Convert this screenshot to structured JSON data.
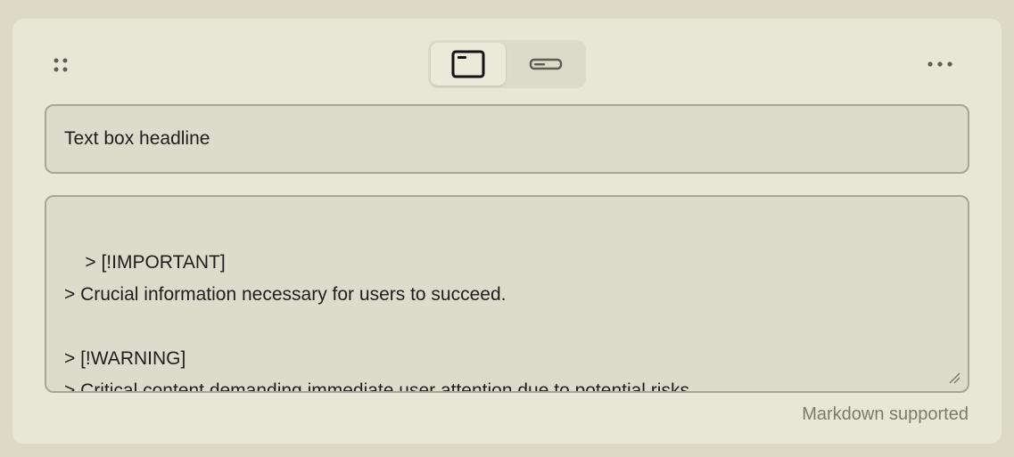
{
  "editor": {
    "headline_value": "Text box headline",
    "body_value": "> [!IMPORTANT]\n> Crucial information necessary for users to succeed.\n\n> [!WARNING]\n> Critical content demanding immediate user attention due to potential risks.",
    "hint": "Markdown supported"
  },
  "toolbar": {
    "drag_icon": "drag-dots-icon",
    "view_options": [
      {
        "icon": "window-frame-icon",
        "selected": true
      },
      {
        "icon": "compact-bar-icon",
        "selected": false
      }
    ],
    "more_icon": "ellipsis-icon"
  },
  "colors": {
    "page_bg": "#dcdac4",
    "card_bg": "#e8e6d6",
    "field_bg": "#dddbcc",
    "field_border": "#a7a597",
    "text": "#1f1e1b",
    "hint_text": "#7b7a70"
  }
}
